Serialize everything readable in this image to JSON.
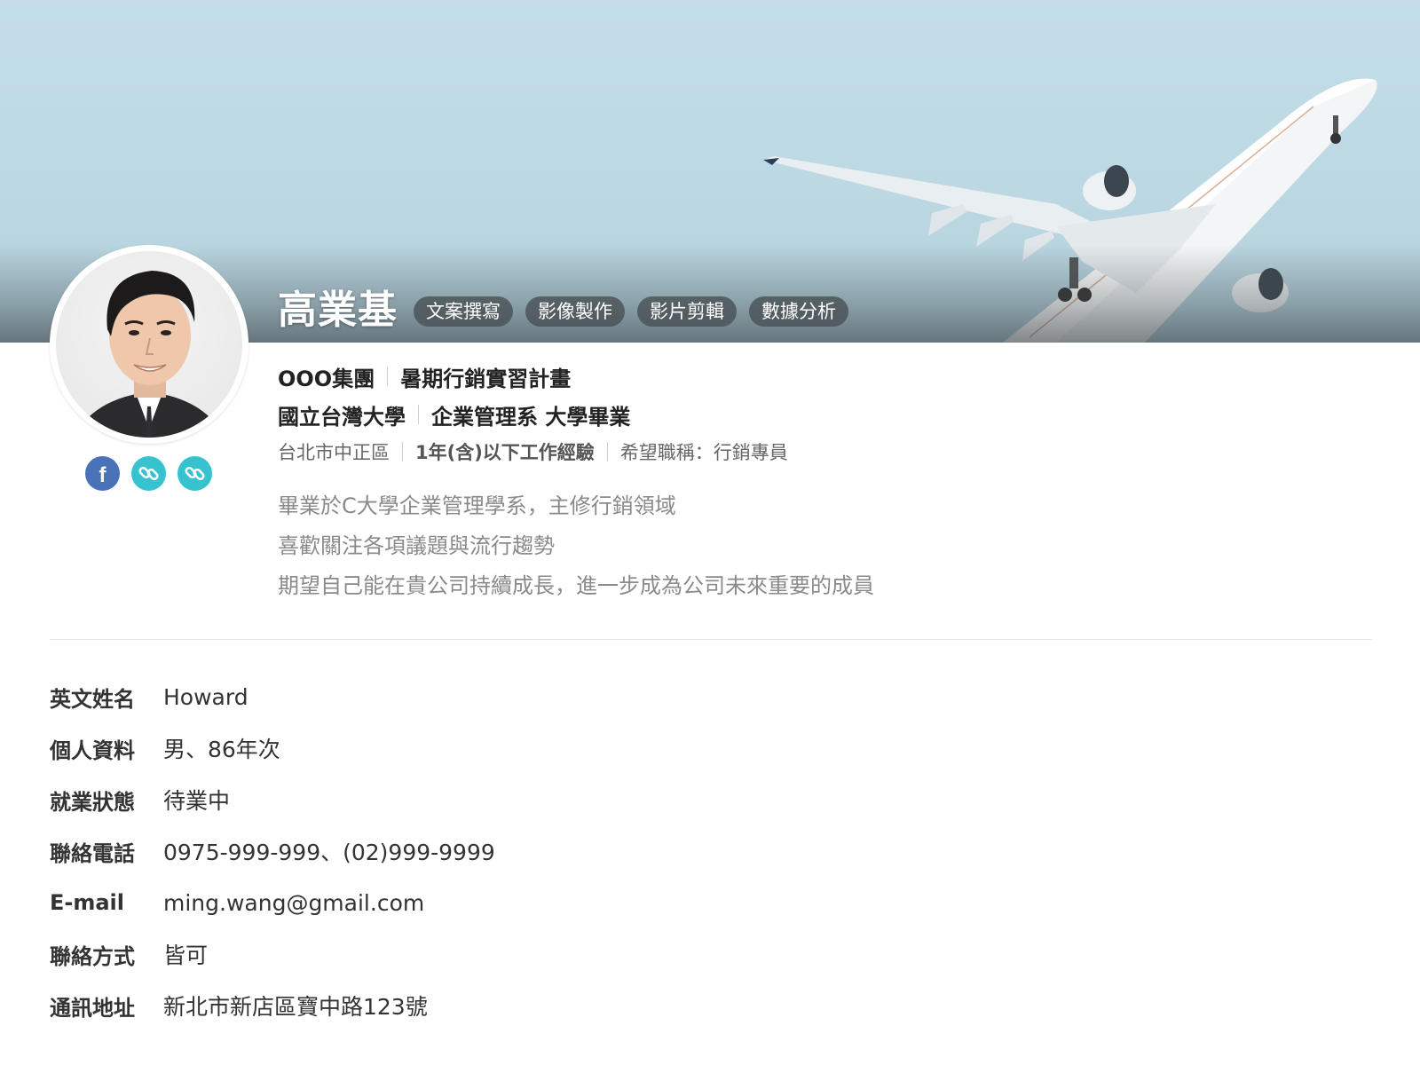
{
  "profile": {
    "name": "高業基",
    "tags": [
      "文案撰寫",
      "影像製作",
      "影片剪輯",
      "數據分析"
    ],
    "company": "OOO集團",
    "program": "暑期行銷實習計畫",
    "school": "國立台灣大學",
    "degree": "企業管理系 大學畢業",
    "location": "台北市中正區",
    "experience": "1年(含)以下工作經驗",
    "desired_title": "希望職稱：行銷專員",
    "bio": [
      "畢業於C大學企業管理學系，主修行銷領域",
      "喜歡關注各項議題與流行趨勢",
      "期望自己能在貴公司持續成長，進一步成為公司未來重要的成員"
    ]
  },
  "socials": [
    {
      "icon": "facebook-icon",
      "color": "#4a72b8"
    },
    {
      "icon": "link-icon",
      "color": "#37c2cf"
    },
    {
      "icon": "link-icon",
      "color": "#37c2cf"
    }
  ],
  "details": [
    {
      "label": "英文姓名",
      "value": "Howard"
    },
    {
      "label": "個人資料",
      "value": "男、86年次"
    },
    {
      "label": "就業狀態",
      "value": "待業中"
    },
    {
      "label": "聯絡電話",
      "value": "0975-999-999、(02)999-9999"
    },
    {
      "label": "E-mail",
      "value": "ming.wang@gmail.com"
    },
    {
      "label": "聯絡方式",
      "value": "皆可"
    },
    {
      "label": "通訊地址",
      "value": "新北市新店區寶中路123號"
    }
  ],
  "colors": {
    "sky": "#c3dee8",
    "tag_bg": "#464e52",
    "facebook": "#4a72b8",
    "link": "#37c2cf"
  }
}
